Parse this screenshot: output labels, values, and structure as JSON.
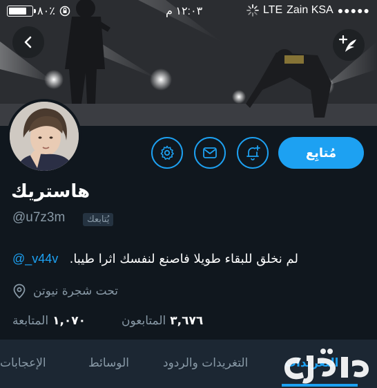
{
  "status_bar": {
    "battery_percent": "٨٠٪",
    "battery_level": 0.8,
    "time": "١٢:٠٣ م",
    "network": "LTE",
    "carrier": "Zain KSA",
    "signal": "●●●●●"
  },
  "nav": {
    "back_icon": "chevron-left-icon",
    "compose_icon": "compose-tweet-icon"
  },
  "profile": {
    "display_name": "هاستريك",
    "handle": "@u7z3m",
    "follows_you": "يُتابعك",
    "bio_text": "لم نخلق للبقاء طويلا فاصنع لنفسك اثرا طيبا.",
    "bio_mention": "@_v44v",
    "location": "تحت شجرة نيوتن",
    "followers_count": "٣,٦٧٦",
    "followers_label": "المتابعون",
    "following_count": "١,٠٧٠",
    "following_label": "المتابعة"
  },
  "actions": {
    "follow_label": "مُتابِع",
    "notification_icon": "bell-plus-icon",
    "message_icon": "envelope-icon",
    "settings_icon": "gear-icon"
  },
  "tabs": [
    {
      "label": "التغريدات",
      "active": true
    },
    {
      "label": "التغريدات والردود",
      "active": false
    },
    {
      "label": "الوسائط",
      "active": false
    },
    {
      "label": "الإعجابات",
      "active": false
    }
  ],
  "colors": {
    "accent": "#1da1f2",
    "background": "#10171e",
    "muted_text": "#8899a6",
    "tab_bar": "#1c2733"
  }
}
